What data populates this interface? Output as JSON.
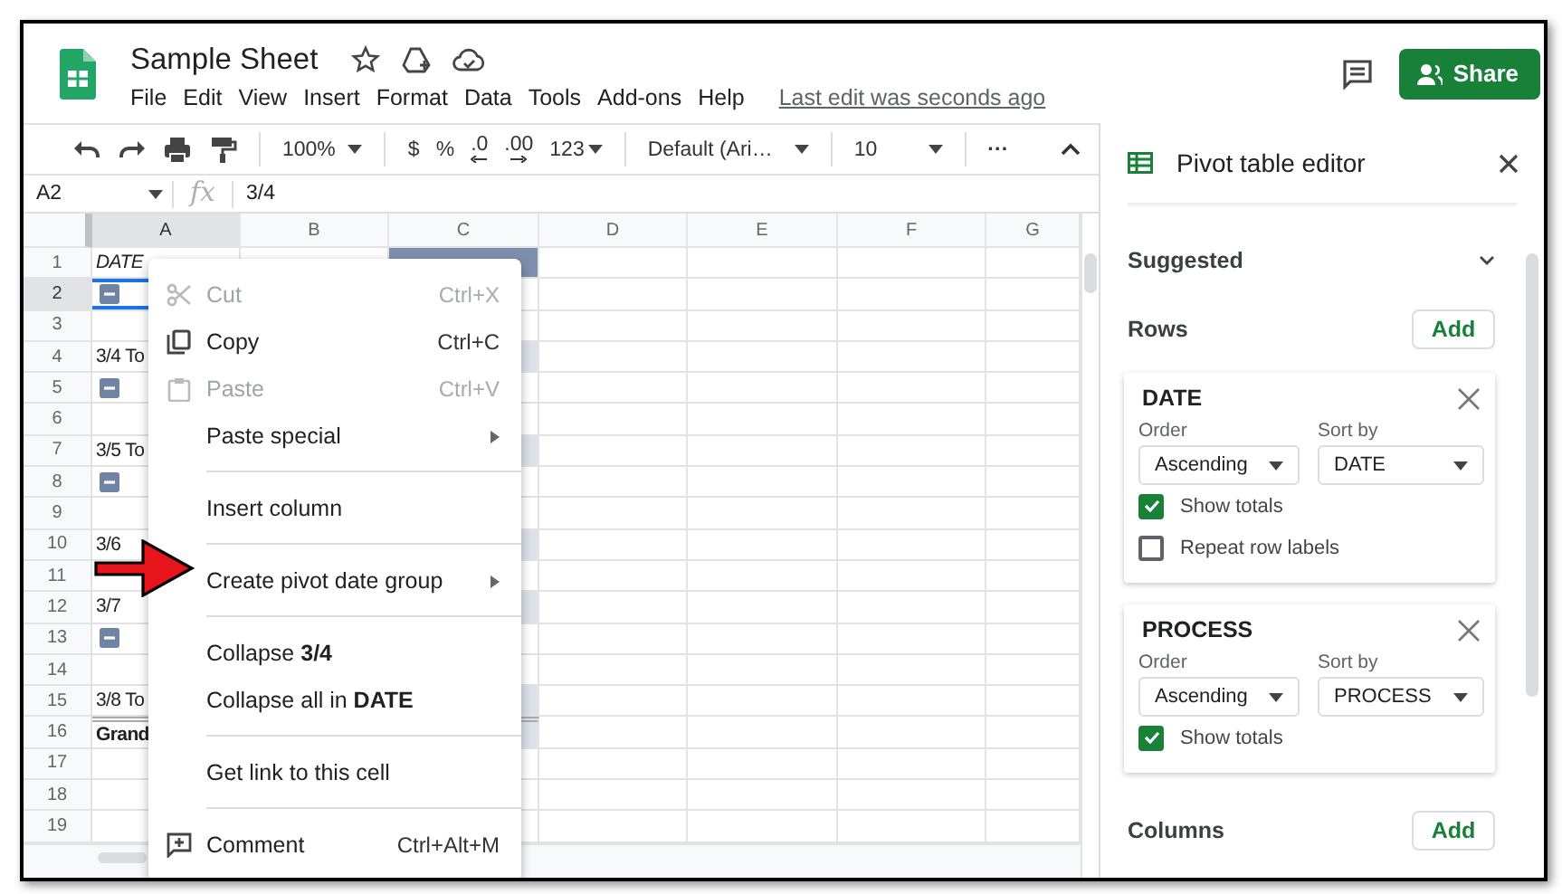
{
  "document": {
    "title": "Sample Sheet",
    "menus": [
      "File",
      "Edit",
      "View",
      "Insert",
      "Format",
      "Data",
      "Tools",
      "Add-ons",
      "Help"
    ],
    "last_edit": "Last edit was seconds ago",
    "share": "Share"
  },
  "toolbar": {
    "zoom": "100%",
    "formats": [
      {
        "label": "$",
        "kind": "plain"
      },
      {
        "label": "%",
        "kind": "plain"
      },
      {
        "label": ".0",
        "kind": "decrease"
      },
      {
        "label": ".00",
        "kind": "increase"
      },
      {
        "label": "123",
        "kind": "dropdown"
      }
    ],
    "font": "Default (Ari…",
    "font_size": "10",
    "more": "···"
  },
  "formula_bar": {
    "cell": "A2",
    "fx": "fx",
    "value": "3/4"
  },
  "grid": {
    "columns": [
      {
        "label": "A",
        "selected": true
      },
      {
        "label": "B",
        "selected": false
      },
      {
        "label": "C",
        "selected": false
      },
      {
        "label": "D",
        "selected": false
      },
      {
        "label": "E",
        "selected": false
      },
      {
        "label": "F",
        "selected": false
      },
      {
        "label": "G",
        "selected": false
      }
    ],
    "rows": [
      {
        "number": "1",
        "selected": false,
        "kind": "header",
        "cell": "DATE"
      },
      {
        "number": "2",
        "selected": true,
        "kind": "group"
      },
      {
        "number": "3",
        "selected": false,
        "kind": "blank"
      },
      {
        "number": "4",
        "selected": false,
        "kind": "total",
        "cell": "3/4 To"
      },
      {
        "number": "5",
        "selected": false,
        "kind": "group"
      },
      {
        "number": "6",
        "selected": false,
        "kind": "blank"
      },
      {
        "number": "7",
        "selected": false,
        "kind": "total",
        "cell": "3/5 To"
      },
      {
        "number": "8",
        "selected": false,
        "kind": "group"
      },
      {
        "number": "9",
        "selected": false,
        "kind": "blank"
      },
      {
        "number": "10",
        "selected": false,
        "kind": "total",
        "cell": "3/6"
      },
      {
        "number": "11",
        "selected": false,
        "kind": "blank"
      },
      {
        "number": "12",
        "selected": false,
        "kind": "total",
        "cell": "3/7"
      },
      {
        "number": "13",
        "selected": false,
        "kind": "group"
      },
      {
        "number": "14",
        "selected": false,
        "kind": "blank"
      },
      {
        "number": "15",
        "selected": false,
        "kind": "total",
        "cell": "3/8 To"
      },
      {
        "number": "16",
        "selected": false,
        "kind": "grand",
        "cell": "Grand"
      },
      {
        "number": "17",
        "selected": false,
        "kind": "blank"
      },
      {
        "number": "18",
        "selected": false,
        "kind": "blank"
      },
      {
        "number": "19",
        "selected": false,
        "kind": "blank"
      }
    ]
  },
  "context_menu": {
    "entries": [
      {
        "kind": "cut",
        "label": "Cut",
        "shortcut": "Ctrl+X",
        "disabled": true,
        "submenu": false
      },
      {
        "kind": "copy",
        "label": "Copy",
        "shortcut": "Ctrl+C",
        "disabled": false,
        "submenu": false
      },
      {
        "kind": "paste",
        "label": "Paste",
        "shortcut": "Ctrl+V",
        "disabled": true,
        "submenu": false
      },
      {
        "kind": "plain",
        "label": "Paste special",
        "disabled": false,
        "submenu": true
      },
      {
        "kind": "divider"
      },
      {
        "kind": "plain",
        "label": "Insert column",
        "disabled": false,
        "submenu": false
      },
      {
        "kind": "divider"
      },
      {
        "kind": "plain",
        "label": "Create pivot date group",
        "disabled": false,
        "submenu": true
      },
      {
        "kind": "divider"
      },
      {
        "kind": "plain",
        "label": "Collapse **3/4**",
        "disabled": false,
        "submenu": false
      },
      {
        "kind": "plain",
        "label": "Collapse all in **DATE**",
        "disabled": false,
        "submenu": false
      },
      {
        "kind": "divider"
      },
      {
        "kind": "plain",
        "label": "Get link to this cell",
        "disabled": false,
        "submenu": false
      },
      {
        "kind": "divider"
      },
      {
        "kind": "comment",
        "label": "Comment",
        "shortcut": "Ctrl+Alt+M",
        "disabled": false,
        "submenu": false
      }
    ]
  },
  "pivot_editor": {
    "title": "Pivot table editor",
    "suggested": "Suggested",
    "sections": [
      {
        "label": "Rows",
        "add": "Add",
        "cards": [
          {
            "title": "DATE",
            "order_label": "Order",
            "order": "Ascending",
            "sort_label": "Sort by",
            "sort": "DATE",
            "options": [
              {
                "label": "Show totals",
                "checked": true
              },
              {
                "label": "Repeat row labels",
                "checked": false
              }
            ]
          },
          {
            "title": "PROCESS",
            "order_label": "Order",
            "order": "Ascending",
            "sort_label": "Sort by",
            "sort": "PROCESS",
            "options": [
              {
                "label": "Show totals",
                "checked": true
              }
            ]
          }
        ]
      },
      {
        "label": "Columns",
        "add": "Add"
      }
    ]
  }
}
